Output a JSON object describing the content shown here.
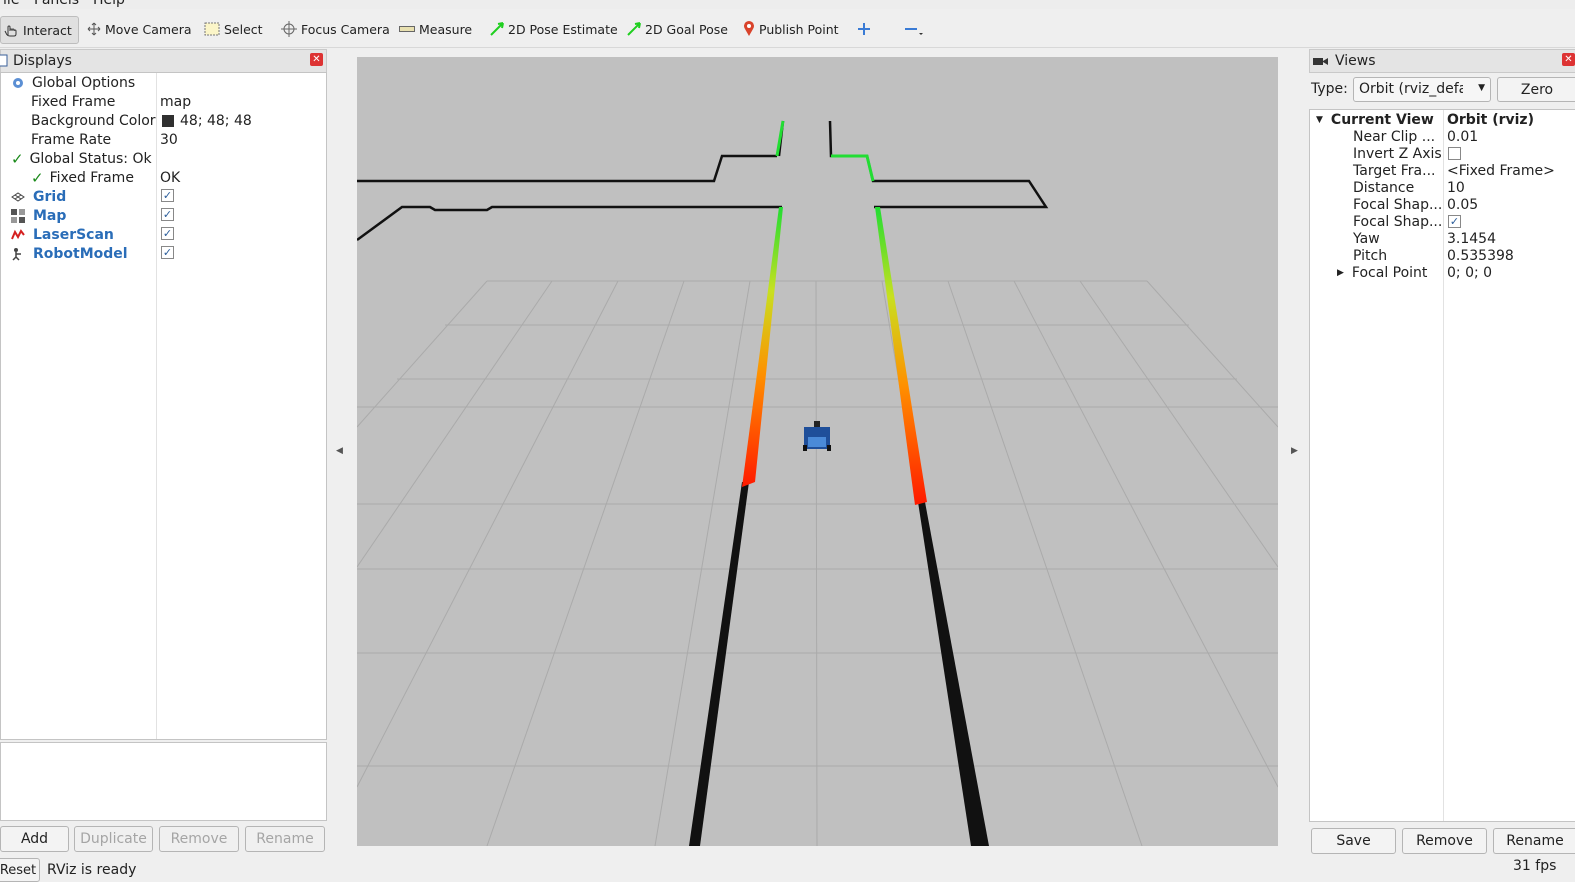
{
  "menu": [
    "File",
    "Panels",
    "Help"
  ],
  "toolbar": {
    "interact": "Interact",
    "move_camera": "Move Camera",
    "select": "Select",
    "focus_camera": "Focus Camera",
    "measure": "Measure",
    "pose_estimate": "2D Pose Estimate",
    "goal_pose": "2D Goal Pose",
    "publish_point": "Publish Point"
  },
  "displays": {
    "title": "Displays",
    "global_options": "Global Options",
    "fixed_frame_label": "Fixed Frame",
    "fixed_frame_value": "map",
    "bg_color_label": "Background Color",
    "bg_color_value": "48; 48; 48",
    "frame_rate_label": "Frame Rate",
    "frame_rate_value": "30",
    "global_status": "Global Status: Ok",
    "status_fixed_frame": "Fixed Frame",
    "status_fixed_frame_value": "OK",
    "items": [
      {
        "label": "Grid",
        "checked": true
      },
      {
        "label": "Map",
        "checked": true
      },
      {
        "label": "LaserScan",
        "checked": true
      },
      {
        "label": "RobotModel",
        "checked": true
      }
    ],
    "buttons": {
      "add": "Add",
      "duplicate": "Duplicate",
      "remove": "Remove",
      "rename": "Rename"
    }
  },
  "views": {
    "title": "Views",
    "type_label": "Type:",
    "type_value": "Orbit (rviz_default_plugins)",
    "zero": "Zero",
    "current_view": "Current View",
    "current_view_value": "Orbit (rviz)",
    "props": [
      {
        "label": "Near Clip ...",
        "value": "0.01"
      },
      {
        "label": "Invert Z Axis",
        "value": ""
      },
      {
        "label": "Target Fra...",
        "value": "<Fixed Frame>"
      },
      {
        "label": "Distance",
        "value": "10"
      },
      {
        "label": "Focal Shap...",
        "value": "0.05"
      },
      {
        "label": "Focal Shap...",
        "value": ""
      },
      {
        "label": "Yaw",
        "value": "3.1454"
      },
      {
        "label": "Pitch",
        "value": "0.535398"
      },
      {
        "label": "Focal Point",
        "value": "0; 0; 0"
      }
    ],
    "buttons": {
      "save": "Save",
      "remove": "Remove",
      "rename": "Rename"
    }
  },
  "status": {
    "reset": "Reset",
    "message": "RViz is ready",
    "fps": "31 fps"
  },
  "colors": {
    "bg_swatch": "#303030",
    "link_blue": "#2a6db8",
    "viewport_bg": "#c0c0c0"
  }
}
